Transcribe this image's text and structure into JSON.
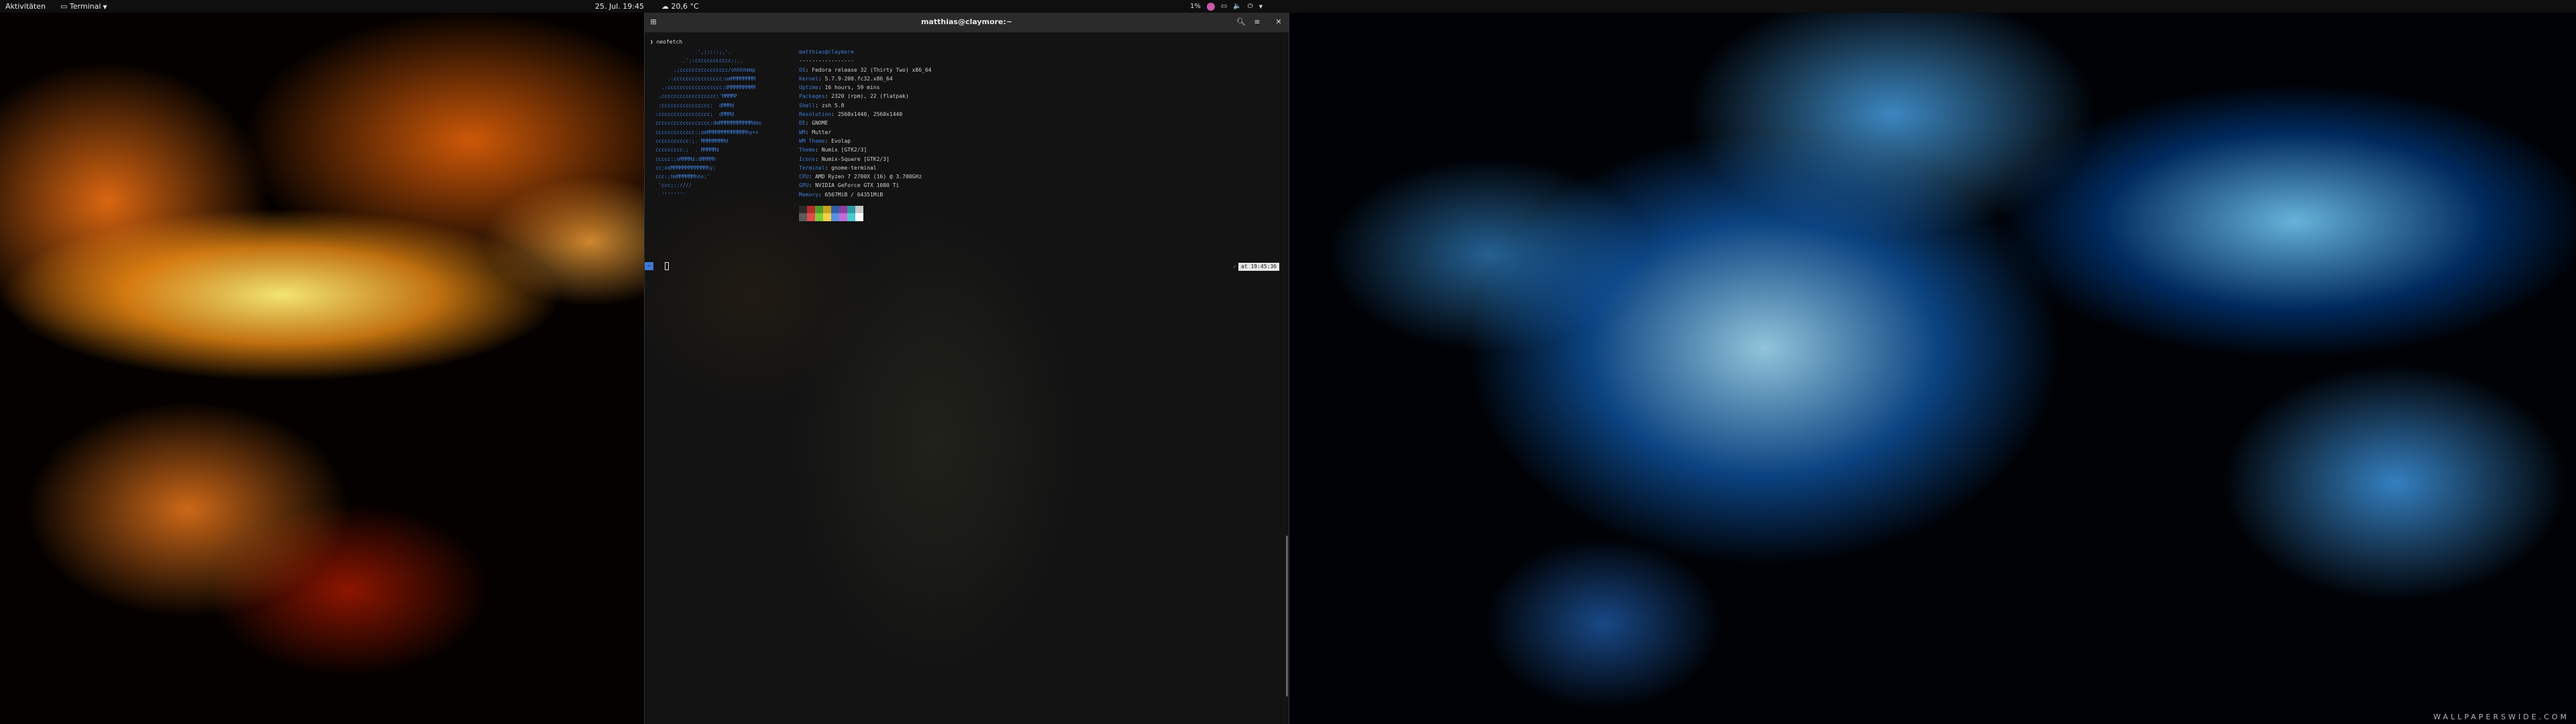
{
  "topbar": {
    "activities": "Aktivitäten",
    "app_menu": "Terminal",
    "clock": "25. Jul. 19:45",
    "weather": "20,6 °C",
    "system_status": "1%"
  },
  "window": {
    "title": "matthias@claymore:~"
  },
  "terminal": {
    "command": "❯ neofetch",
    "logo_lines": [
      "             .',;::::;,'.",
      "         .';:cccccccccccc:;,.",
      "      .;cccccccccccccccc/ohhhhmmp",
      "    .:cccccccccccccccc:omMMMMMMMM",
      "  .:cccccccccccccccccc;dMMMMMMMMM",
      " ,cccccccccccccccccc;'MMMMP",
      " :cccccccccccccccc;  dMMMd",
      ":ccccccccccccccccc;  dMMMd",
      "cccccccccccccccccc:dmMMMMMMMMMMMdmo",
      "ccccccccccccc:;omMMMMMMMMMMMMMhy++",
      "ccccccccccc:;. MMMMMMMMd",
      "ccccccccc:;  . MMMMMd",
      "ccccc:;oMMMMd:dMMMMh",
      "cc;odMMMMMMMMMMMMhy;",
      "ccc:;hmMMMMMMhhs;'",
      " 'ccc;::////",
      "  ''''''''"
    ],
    "user_host": "matthias@claymore",
    "separator": "-----------------",
    "info": [
      {
        "key": "OS",
        "value": "Fedora release 32 (Thirty Two) x86_64"
      },
      {
        "key": "Kernel",
        "value": "5.7.9-200.fc32.x86_64"
      },
      {
        "key": "Uptime",
        "value": "16 hours, 59 mins"
      },
      {
        "key": "Packages",
        "value": "2320 (rpm), 22 (flatpak)"
      },
      {
        "key": "Shell",
        "value": "zsh 5.8"
      },
      {
        "key": "Resolution",
        "value": "2560x1440, 2560x1440"
      },
      {
        "key": "DE",
        "value": "GNOME"
      },
      {
        "key": "WM",
        "value": "Mutter"
      },
      {
        "key": "WM Theme",
        "value": "Evolap"
      },
      {
        "key": "Theme",
        "value": "Numix [GTK2/3]"
      },
      {
        "key": "Icons",
        "value": "Numix-Square [GTK2/3]"
      },
      {
        "key": "Terminal",
        "value": "gnome-terminal"
      },
      {
        "key": "CPU",
        "value": "AMD Ryzen 7 2700X (16) @ 3.700GHz"
      },
      {
        "key": "GPU",
        "value": "NVIDIA GeForce GTX 1080 Ti"
      },
      {
        "key": "Memory",
        "value": "6567MiB / 64351MiB"
      }
    ],
    "swatches_row1": [
      "#2a2a2a",
      "#b72a2a",
      "#4f9a2a",
      "#c7a21a",
      "#2f5fa8",
      "#8a3fa0",
      "#2a9aa0",
      "#c8c8c8"
    ],
    "swatches_row2": [
      "#5a5a5a",
      "#e04a4a",
      "#7ccc3a",
      "#f1d04a",
      "#5a8fe0",
      "#c56ad8",
      "#4ac8d0",
      "#ffffff"
    ],
    "prompt_badge": "~",
    "right_prompt_check": "✓",
    "right_prompt_time": "at 19:45:36"
  },
  "wallpaper": {
    "watermark": "WALLPAPERSWIDE.COM"
  }
}
